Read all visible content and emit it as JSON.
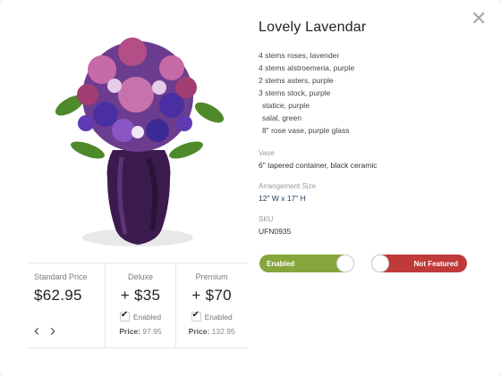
{
  "product": {
    "title": "Lovely Lavendar",
    "items": [
      "4 stems roses, lavender",
      "4 stems alstroemeria, purple",
      "2 stems asters, purple",
      "3 stems stock, purple",
      "  statice, purple",
      "  salal, green",
      "  8\" rose vase, purple glass"
    ],
    "vase_label": "Vase",
    "vase_value": "6\" tapered container, black ceramic",
    "size_label": "Arrangement Size",
    "size_value": "12\" W x 17\" H",
    "sku_label": "SKU",
    "sku_value": "UFN0935"
  },
  "pricing": {
    "standard_label": "Standard Price",
    "standard_amount": "$62.95",
    "deluxe_label": "Deluxe",
    "deluxe_amount": "+ $35",
    "deluxe_enabled_label": "Enabled",
    "deluxe_price_label": "Price:",
    "deluxe_price_value": "97.95",
    "premium_label": "Premium",
    "premium_amount": "+ $70",
    "premium_enabled_label": "Enabled",
    "premium_price_label": "Price:",
    "premium_price_value": "132.95"
  },
  "toggles": {
    "enabled_label": "Enabled",
    "featured_label": "Not Featured"
  },
  "icons": {
    "close": "close-icon",
    "prev": "chevron-left-icon",
    "next": "chevron-right-icon"
  },
  "colors": {
    "enabled_toggle": "#86a63d",
    "not_featured_toggle": "#c03a3a"
  }
}
